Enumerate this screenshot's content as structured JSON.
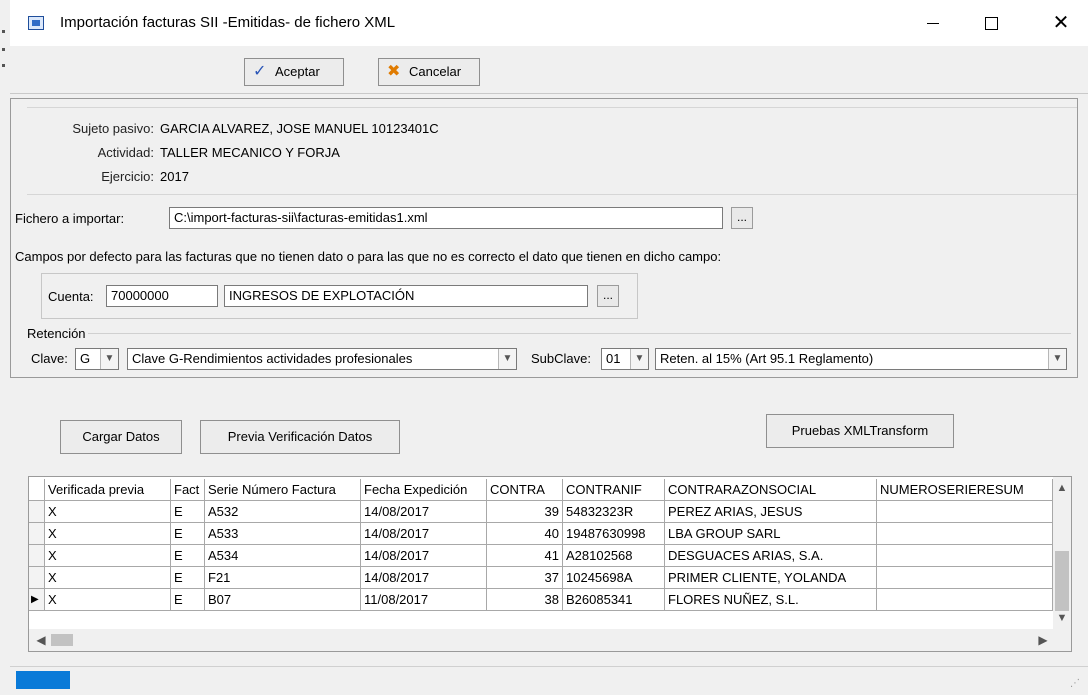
{
  "window": {
    "title": "Importación facturas SII -Emitidas- de fichero XML",
    "controls": [
      "minimize",
      "maximize",
      "close"
    ]
  },
  "toolbar": {
    "accept_label": "Aceptar",
    "cancel_label": "Cancelar"
  },
  "info": {
    "sujeto_label": "Sujeto pasivo:",
    "sujeto_value": "GARCIA ALVAREZ, JOSE MANUEL 10123401C",
    "actividad_label": "Actividad:",
    "actividad_value": "TALLER MECANICO Y FORJA",
    "ejercicio_label": "Ejercicio:",
    "ejercicio_value": "2017"
  },
  "import": {
    "file_label": "Fichero a importar:",
    "file_value": "C:\\import-facturas-sii\\facturas-emitidas1.xml",
    "browse_label": "...",
    "defaults_text": "Campos por defecto para las facturas que no tienen dato o para las que no es correcto el dato que tienen en dicho campo:"
  },
  "cuenta": {
    "label": "Cuenta:",
    "code": "70000000",
    "name": "INGRESOS DE EXPLOTACIÓN",
    "browse_label": "..."
  },
  "retencion": {
    "group_label": "Retención",
    "clave_label": "Clave:",
    "clave_value": "G",
    "clave_desc": "Clave G-Rendimientos actividades profesionales",
    "subclave_label": "SubClave:",
    "subclave_value": "01",
    "subclave_desc": "Reten. al 15% (Art 95.1 Reglamento)"
  },
  "actions": {
    "load": "Cargar Datos",
    "verify": "Previa Verificación Datos",
    "xml_test": "Pruebas XMLTransform"
  },
  "grid": {
    "columns": [
      "Verificada previa",
      "Fact",
      "Serie Número Factura",
      "Fecha Expedición",
      "CONTRA",
      "CONTRANIF",
      "CONTRARAZONSOCIAL",
      "NUMEROSERIERESUM"
    ],
    "rows": [
      [
        "X",
        "E",
        "A532",
        "14/08/2017",
        "39",
        "54832323R",
        "PEREZ ARIAS, JESUS",
        ""
      ],
      [
        "X",
        "E",
        "A533",
        "14/08/2017",
        "40",
        "19487630998",
        "LBA GROUP SARL",
        ""
      ],
      [
        "X",
        "E",
        "A534",
        "14/08/2017",
        "41",
        "A28102568",
        "DESGUACES ARIAS, S.A.",
        ""
      ],
      [
        "X",
        "E",
        "F21",
        "14/08/2017",
        "37",
        "10245698A",
        "PRIMER CLIENTE, YOLANDA",
        ""
      ],
      [
        "X",
        "E",
        "B07",
        "11/08/2017",
        "38",
        "B26085341",
        "FLORES NUÑEZ, S.L.",
        ""
      ]
    ],
    "current_row": 4
  },
  "colors": {
    "status_fill": "#0a7ad8",
    "window_bg": "#f0f0f0"
  }
}
